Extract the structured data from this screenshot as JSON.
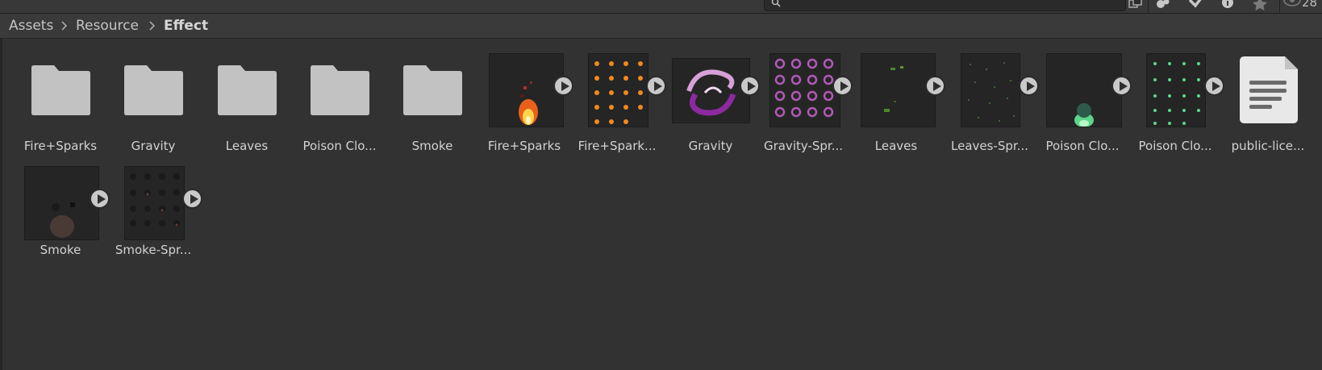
{
  "toolbar": {
    "search": {
      "value": "",
      "placeholder": ""
    },
    "count_label": "28",
    "buttons": [
      "search-by-type",
      "search-by-label",
      "filter-by-type",
      "info",
      "favorites",
      "visibility"
    ]
  },
  "breadcrumb": {
    "items": [
      "Assets",
      "Resource",
      "Effect"
    ]
  },
  "assets": {
    "row1": [
      {
        "label": "Fire+Sparks",
        "kind": "folder"
      },
      {
        "label": "Gravity",
        "kind": "folder"
      },
      {
        "label": "Leaves",
        "kind": "folder"
      },
      {
        "label": "Poison Clo...",
        "kind": "folder"
      },
      {
        "label": "Smoke",
        "kind": "folder"
      },
      {
        "label": "Fire+Sparks",
        "kind": "prefab"
      },
      {
        "label": "Fire+Spark...",
        "kind": "spritesheet"
      },
      {
        "label": "Gravity",
        "kind": "prefab"
      },
      {
        "label": "Gravity-Spr...",
        "kind": "spritesheet"
      },
      {
        "label": "Leaves",
        "kind": "prefab"
      },
      {
        "label": "Leaves-Spr...",
        "kind": "spritesheet"
      },
      {
        "label": "Poison Clo...",
        "kind": "prefab"
      },
      {
        "label": "Poison Clo...",
        "kind": "spritesheet"
      },
      {
        "label": "public-lice...",
        "kind": "text"
      }
    ],
    "row2": [
      {
        "label": "Smoke",
        "kind": "prefab"
      },
      {
        "label": "Smoke-Spr...",
        "kind": "spritesheet"
      }
    ]
  },
  "colors": {
    "background": "#323232",
    "breadcrumb_bar": "#3a3a3a",
    "folder": "#c2c2c2",
    "play_button": "#c9c9c9"
  }
}
